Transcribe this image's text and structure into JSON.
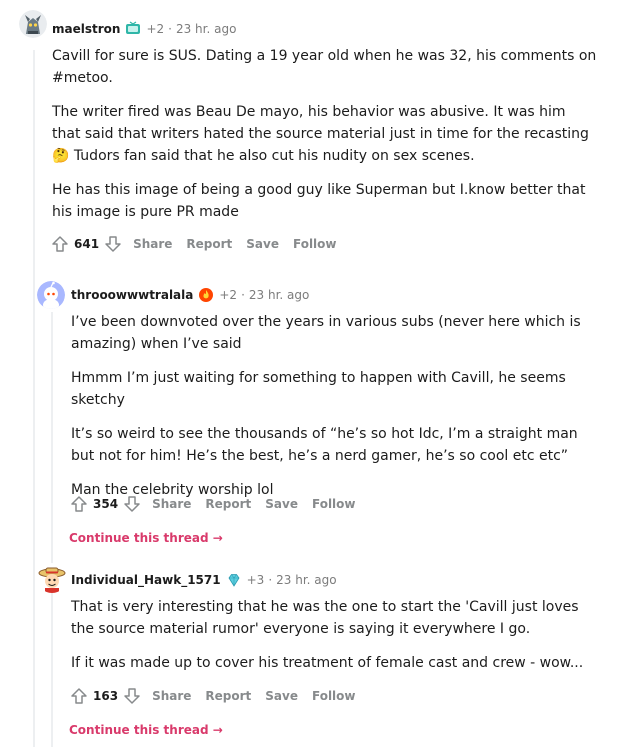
{
  "comments": [
    {
      "username": "maelstron",
      "flair_icon": "tv-icon",
      "award_count": "+2",
      "separator": "·",
      "time": "23 hr. ago",
      "paragraphs": [
        "Cavill for sure is SUS. Dating a 19 year old when he was 32, his comments on #metoo.",
        "The writer fired was Beau De mayo, his behavior was abusive. It was him that said that writers hated the source material just in time for the recasting 🤔 Tudors fan said that he also cut his nudity on sex scenes.",
        "He has this image of being a good guy like Superman but I.know better that his image is pure PR made"
      ],
      "score": "641",
      "actions": [
        "Share",
        "Report",
        "Save",
        "Follow"
      ]
    },
    {
      "username": "throoowwwtralala",
      "flair_icon": "fire-award-icon",
      "award_count": "+2",
      "separator": "·",
      "time": "23 hr. ago",
      "paragraphs": [
        "I’ve been downvoted over the years in various subs (never here which is amazing) when I’ve said",
        "Hmmm I’m just waiting for something to happen with Cavill, he seems sketchy",
        "It’s so weird to see the thousands of “he’s so hot Idc, I’m a straight man but not for him! He’s the best, he’s a nerd gamer, he’s so cool etc etc”",
        "Man the celebrity worship lol"
      ],
      "score": "354",
      "actions": [
        "Share",
        "Report",
        "Save",
        "Follow"
      ],
      "continue_label": "Continue this thread →"
    },
    {
      "username": "Individual_Hawk_1571",
      "flair_icon": "diamond-award-icon",
      "award_count": "+3",
      "separator": "·",
      "time": "23 hr. ago",
      "paragraphs": [
        "That is very interesting that he was the one to start the 'Cavill just loves the source material rumor' everyone is saying it everywhere I go.",
        "If it was made up to cover his treatment of female cast and crew - wow..."
      ],
      "score": "163",
      "actions": [
        "Share",
        "Report",
        "Save",
        "Follow"
      ],
      "continue_label": "Continue this thread →"
    }
  ],
  "colors": {
    "continue_link": "#d93a6b",
    "muted": "#7c7c7c",
    "thread_line": "#edeff1"
  }
}
